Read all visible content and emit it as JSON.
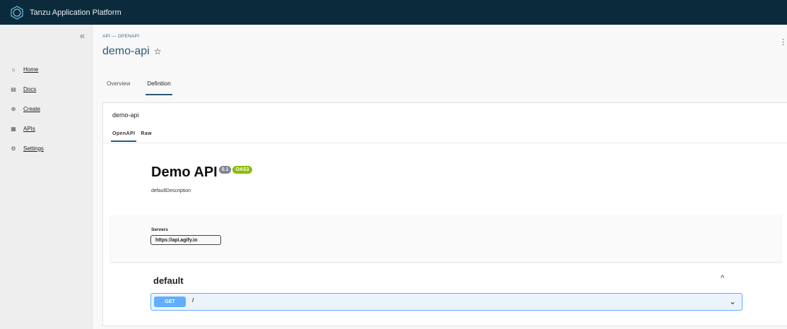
{
  "app": {
    "title": "Tanzu Application Platform"
  },
  "sidebar": {
    "collapse_icon": "«",
    "items": [
      {
        "label": "Home",
        "icon": "home-icon",
        "glyph": "⌂"
      },
      {
        "label": "Docs",
        "icon": "docs-icon",
        "glyph": "▤"
      },
      {
        "label": "Create",
        "icon": "create-icon",
        "glyph": "⊕"
      },
      {
        "label": "APIs",
        "icon": "apis-icon",
        "glyph": "▦"
      },
      {
        "label": "Settings",
        "icon": "settings-icon",
        "glyph": "⚙"
      }
    ]
  },
  "header": {
    "breadcrumb": "API — OPENAPI",
    "title": "demo-api",
    "star_glyph": "☆",
    "menu_glyph": "⋮"
  },
  "tabs": [
    {
      "label": "Overview",
      "active": false
    },
    {
      "label": "Definition",
      "active": true
    }
  ],
  "card": {
    "title": "demo-api",
    "subtabs": [
      {
        "label": "OpenAPI",
        "active": true
      },
      {
        "label": "Raw",
        "active": false
      }
    ]
  },
  "spec": {
    "title": "Demo API",
    "version": "0.1",
    "oas_badge": "OAS3",
    "description": "defaultDescription",
    "servers_label": "Servers",
    "server_value": "https://api.agify.io",
    "group": "default",
    "group_caret": "^",
    "operation": {
      "method": "GET",
      "path": "/",
      "chevron": "⌄"
    }
  },
  "colors": {
    "topbar": "#0b2b3d",
    "accent": "#2c5a78",
    "get_method": "#61affe",
    "oas_badge": "#89bf04"
  }
}
